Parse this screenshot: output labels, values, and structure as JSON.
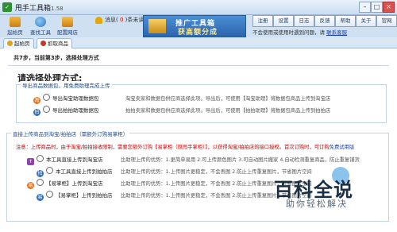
{
  "window": {
    "title": "甩手工具箱",
    "version": "1.58"
  },
  "toolbar": {
    "items": [
      {
        "label": "起始页",
        "icon": "home-icon"
      },
      {
        "label": "查找工具",
        "icon": "search-icon"
      },
      {
        "label": "配置网店",
        "icon": "shop-icon"
      }
    ],
    "message_label": "消息(",
    "message_count": "0",
    "message_suffix": ")条未读"
  },
  "banner": {
    "line1": "推广工具箱",
    "line2": "获高额分成"
  },
  "topright": {
    "buttons": [
      "注册",
      "设置",
      "日志",
      "反馈",
      "帮助",
      "关于",
      "官网"
    ],
    "hint": "不会使用或使用时遇到问题，请",
    "hint_link": "联系客服"
  },
  "tabs": [
    {
      "label": "起始页",
      "icon": "home-icon"
    },
    {
      "label": "抓取商品",
      "icon": "capture-icon"
    }
  ],
  "step_text": "共7步，当前第3步，选择处理方式",
  "heading": "请选择处理方式:",
  "group1": {
    "legend": "导出商品数据包，用免费助理完成上传",
    "options": [
      {
        "label": "导出淘宝助理数据包",
        "desc": "淘宝卖家和数据包供应商选择此项。导出后，可使用【淘宝助理】将数据包商品上传到淘宝店",
        "icon": "taobao-icon"
      },
      {
        "label": "导出拍拍助理数据包",
        "desc": "拍拍卖家和数据包供应商选择此项。导出后，可使用【拍拍助理】将数据包商品上传到拍拍店",
        "icon": "paipai-icon"
      }
    ]
  },
  "group2": {
    "legend": "直接上传商品到淘宝/拍拍店（需额外订购易掌柜）",
    "note_start": "注意：上传商品时，由于淘宝/拍拍接收限制，需要您",
    "note_order": "额外订购【易掌柜（原甩手掌柜）】",
    "note_mid": "，以获得淘宝/拍拍店的接口授权。首次订购时，可订购",
    "note_free": "免费试用版",
    "options": [
      {
        "label": "本工具直接上传到淘宝店",
        "desc": "比助理上传的优势：1.更简单易用 2.可上传颜色图片 3.可自动图片搬家 4.自动检测重复商品，防止重复铺货",
        "icon": "upload-icon"
      },
      {
        "label": "本工具直接上传到拍拍店",
        "desc": "比助理上传的优势：1.上传图片更稳定，不会丢图 2.防止上传重复图片，节省图片空间",
        "icon": "upload-icon"
      },
      {
        "label": "【易掌柜】上传到淘宝店",
        "desc": "比助理上传的优势：1.上传图片更稳定，不会丢图 2.防止上传重复图片，节省图片空间",
        "icon": "yzg-icon"
      },
      {
        "label": "【易掌柜】上传到拍拍店",
        "desc": "比助理上传的优势：1.上传图片更稳定，不会丢图 2.防止上传重复图片，节省图片空间",
        "icon": "yzg-icon"
      }
    ]
  },
  "watermark": {
    "title": "百科全说",
    "subtitle": "助你轻松解决"
  }
}
